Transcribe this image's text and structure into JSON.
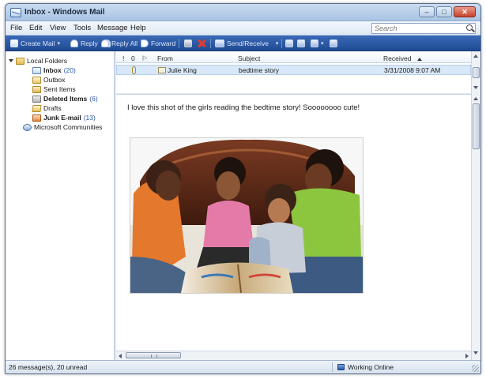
{
  "window": {
    "title": "Inbox - Windows Mail"
  },
  "window_controls": {
    "minimize": "–",
    "maximize": "□",
    "close": "✕"
  },
  "menu": [
    "File",
    "Edit",
    "View",
    "Tools",
    "Message",
    "Help"
  ],
  "search": {
    "placeholder": "Search"
  },
  "toolbar": {
    "create_mail": "Create Mail",
    "reply": "Reply",
    "reply_all": "Reply All",
    "forward": "Forward",
    "send_receive": "Send/Receive",
    "caret": "▾"
  },
  "folders": {
    "root": "Local Folders",
    "items": [
      {
        "name": "Inbox",
        "count": "(20)",
        "bold": true
      },
      {
        "name": "Outbox",
        "count": "",
        "bold": false
      },
      {
        "name": "Sent Items",
        "count": "",
        "bold": false
      },
      {
        "name": "Deleted Items",
        "count": "(6)",
        "bold": true
      },
      {
        "name": "Drafts",
        "count": "",
        "bold": false
      },
      {
        "name": "Junk E-mail",
        "count": "(13)",
        "bold": true
      }
    ],
    "community": "Microsoft Communities"
  },
  "message_list": {
    "headers": {
      "priority": "!",
      "attachment": "0",
      "flag": "⚐",
      "from": "From",
      "subject": "Subject",
      "received": "Received"
    },
    "rows": [
      {
        "from": "Julie King",
        "subject": "bedtime story",
        "received": "3/31/2008 9:07 AM"
      }
    ]
  },
  "preview": {
    "body": "I love this shot of the girls reading the bedtime story! Soooooooo cute!"
  },
  "status": {
    "summary": "26 message(s), 20 unread",
    "connection": "Working Online"
  },
  "colors": {
    "titlebar": "#a9c4e4",
    "toolbar": "#1f4a92",
    "selected_row": "#d9e8f8",
    "count_text": "#2a5aa6"
  }
}
